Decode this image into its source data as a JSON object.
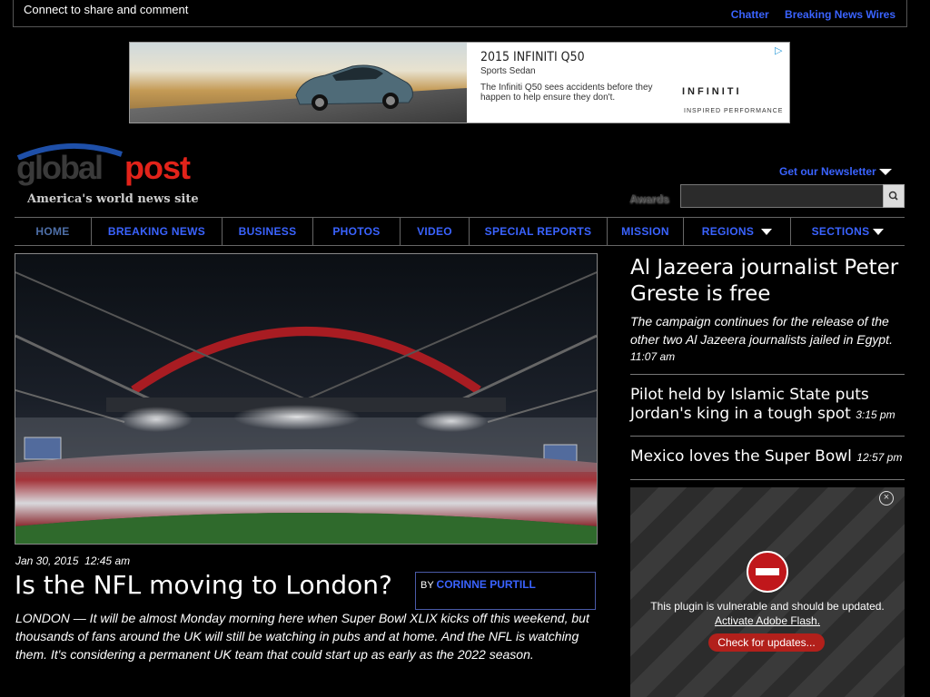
{
  "topbar": {
    "connect_text": "Connect to share and comment",
    "links": [
      "Chatter",
      "Breaking News Wires"
    ]
  },
  "ad": {
    "title": "2015 INFINITI Q50",
    "subtitle": "Sports Sedan",
    "description": "The Infiniti Q50 sees accidents before they happen to help ensure they don't.",
    "brand": "INFINITI",
    "brand_tagline": "INSPIRED PERFORMANCE"
  },
  "header": {
    "logo_global": "global",
    "logo_post": "post",
    "tagline": "America's world news site",
    "newsletter": "Get our Newsletter",
    "awards": "Awards",
    "search_placeholder": ""
  },
  "nav": {
    "items": [
      "HOME",
      "BREAKING NEWS",
      "BUSINESS",
      "PHOTOS",
      "VIDEO",
      "SPECIAL REPORTS",
      "MISSION",
      "REGIONS",
      "SECTIONS"
    ]
  },
  "main": {
    "date": "Jan 30, 2015",
    "time": "12:45 am",
    "headline": "Is the NFL moving to London?",
    "byline_prefix": "BY",
    "author": "CORINNE PURTILL",
    "lede": "LONDON — It will be almost Monday morning here when Super Bowl XLIX kicks off this weekend, but thousands of fans around the UK will still be watching in pubs and at home. And the NFL is watching them. It's considering a permanent UK team that could start up as early as the 2022 season."
  },
  "sidebar": {
    "story1": {
      "title": "Al Jazeera journalist Peter Greste is free",
      "desc": "The campaign continues for the release of the other two Al Jazeera journalists jailed in Egypt.",
      "time": "11:07 am"
    },
    "story2": {
      "title": "Pilot held by Islamic State puts Jordan's king in a tough spot",
      "time": "3:15 pm"
    },
    "story3": {
      "title": "Mexico loves the Super Bowl",
      "time": "12:57 pm"
    }
  },
  "plugin": {
    "message": "This plugin is vulnerable and should be updated.",
    "activate": "Activate Adobe Flash.",
    "check": "Check for updates..."
  }
}
